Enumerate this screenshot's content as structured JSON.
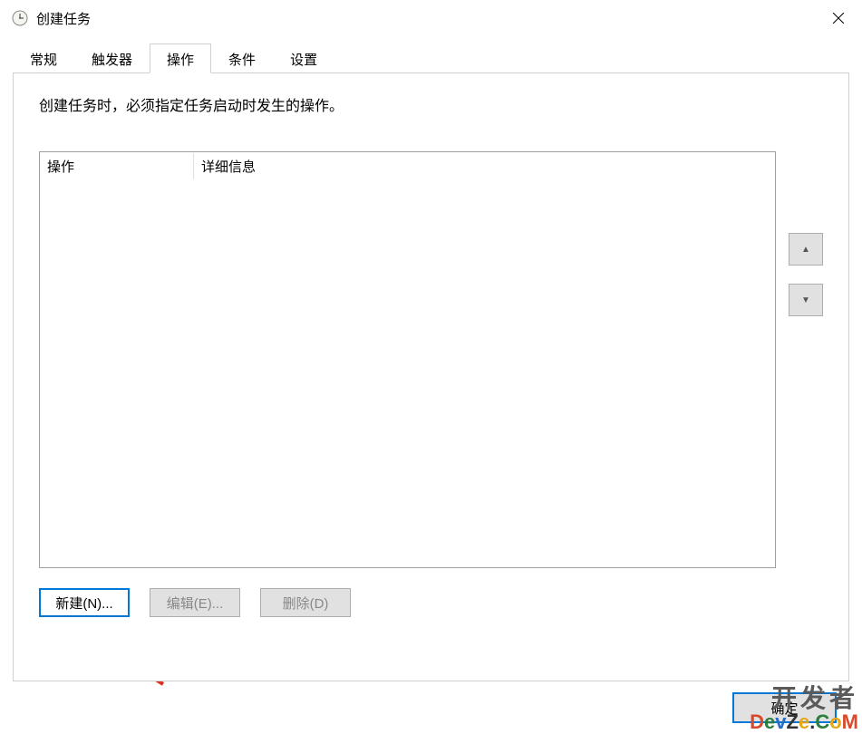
{
  "window": {
    "title": "创建任务"
  },
  "tabs": {
    "items": [
      {
        "label": "常规",
        "active": false
      },
      {
        "label": "触发器",
        "active": false
      },
      {
        "label": "操作",
        "active": true
      },
      {
        "label": "条件",
        "active": false
      },
      {
        "label": "设置",
        "active": false
      }
    ]
  },
  "panel": {
    "description": "创建任务时，必须指定任务启动时发生的操作。",
    "table": {
      "columns": {
        "action": "操作",
        "detail": "详细信息"
      },
      "rows": []
    },
    "arrows": {
      "up": "▲",
      "down": "▼"
    },
    "buttons": {
      "new": "新建(N)...",
      "edit": "编辑(E)...",
      "delete": "删除(D)"
    }
  },
  "footer": {
    "ok": "确定"
  },
  "watermark": {
    "line1": "开发者",
    "line2_chars": [
      "D",
      "e",
      "v",
      "Z",
      "e",
      ".",
      "C",
      "o",
      "M"
    ]
  }
}
